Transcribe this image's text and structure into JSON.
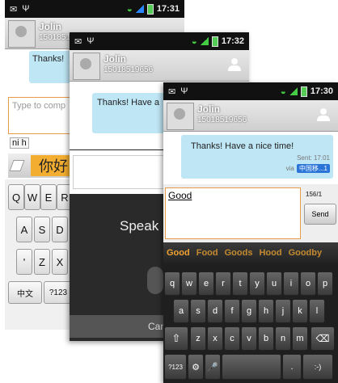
{
  "status": {
    "time1": "17:31",
    "time2": "17:32",
    "time3": "17:30"
  },
  "contact": {
    "name": "Jolin",
    "number": "15018519656",
    "number_partial": "15018519"
  },
  "screen1": {
    "bubble_text": "Thanks!",
    "compose_placeholder": "Type to comp",
    "pinyin": "ni h",
    "candidate": "你好",
    "keys_row1": [
      "Q",
      "W",
      "E",
      "R"
    ],
    "keys_row2": [
      "A",
      "S",
      "D"
    ],
    "keys_row3": [
      "'",
      "Z",
      "X"
    ],
    "key_chinese": "中文",
    "key_num": "?123"
  },
  "screen2": {
    "bubble_text": "Thanks! Have a",
    "speak_text": "Speak",
    "cancel_text": "Canc"
  },
  "screen3": {
    "bubble_text": "Thanks! Have a nice time!",
    "sent_time": "Sent: 17:01",
    "via_label": "via",
    "via_badge": "中国移...1",
    "compose_text": "Good",
    "char_count": "156/1",
    "send_label": "Send",
    "suggestions": [
      "Good",
      "Food",
      "Goods",
      "Hood",
      "Goodby"
    ],
    "keys_row1": [
      "q",
      "w",
      "e",
      "r",
      "t",
      "y",
      "u",
      "i",
      "o",
      "p"
    ],
    "keys_row2": [
      "a",
      "s",
      "d",
      "f",
      "g",
      "h",
      "j",
      "k",
      "l"
    ],
    "keys_row3": [
      "z",
      "x",
      "c",
      "v",
      "b",
      "n",
      "m"
    ],
    "key_num": "?123",
    "key_period": ".",
    "key_smiley": ":-)"
  },
  "colors": {
    "bubble": "#bfe6f5",
    "suggestion": "#f0a030",
    "status_green": "#44cc44"
  }
}
